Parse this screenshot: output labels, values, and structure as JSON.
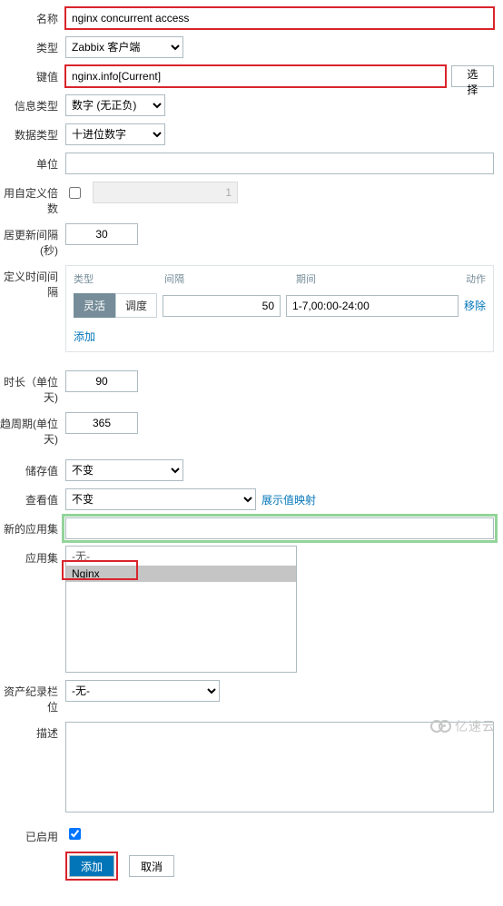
{
  "labels": {
    "name": "名称",
    "type": "类型",
    "key": "键值",
    "info_type": "信息类型",
    "data_type": "数据类型",
    "unit": "单位",
    "multiplier": "用自定义倍数",
    "update_interval": "居更新间隔(秒)",
    "custom_interval": "定义时间间隔",
    "history_days": "时长（单位天)",
    "trend_days": "趋周期(单位天)",
    "store_value": "储存值",
    "show_value": "查看值",
    "new_app": "新的应用集",
    "app": "应用集",
    "inventory_field": "资产纪录栏位",
    "description": "描述",
    "enabled": "已启用"
  },
  "values": {
    "name": "nginx concurrent access",
    "type": "Zabbix 客户端",
    "key": "nginx.info[Current]",
    "select_btn": "选择",
    "info_type": "数字 (无正负)",
    "data_type": "十进位数字",
    "unit": "",
    "multiplier_checked": false,
    "multiplier_value": "1",
    "update_interval": "30",
    "history_days": "90",
    "trend_days": "365",
    "store_value": "不变",
    "show_value": "不变",
    "show_value_link": "展示值映射",
    "new_app": "",
    "app_options": [
      "-无-",
      "Nginx"
    ],
    "app_selected_index": 1,
    "inventory_field": "-无-",
    "description": "",
    "enabled": true
  },
  "interval": {
    "head_type": "类型",
    "head_interval": "间隔",
    "head_period": "期间",
    "head_action": "动作",
    "seg_flex": "灵活",
    "seg_sched": "调度",
    "value": "50",
    "period": "1-7,00:00-24:00",
    "remove": "移除",
    "add": "添加"
  },
  "buttons": {
    "add": "添加",
    "cancel": "取消"
  },
  "watermark": "亿速云"
}
